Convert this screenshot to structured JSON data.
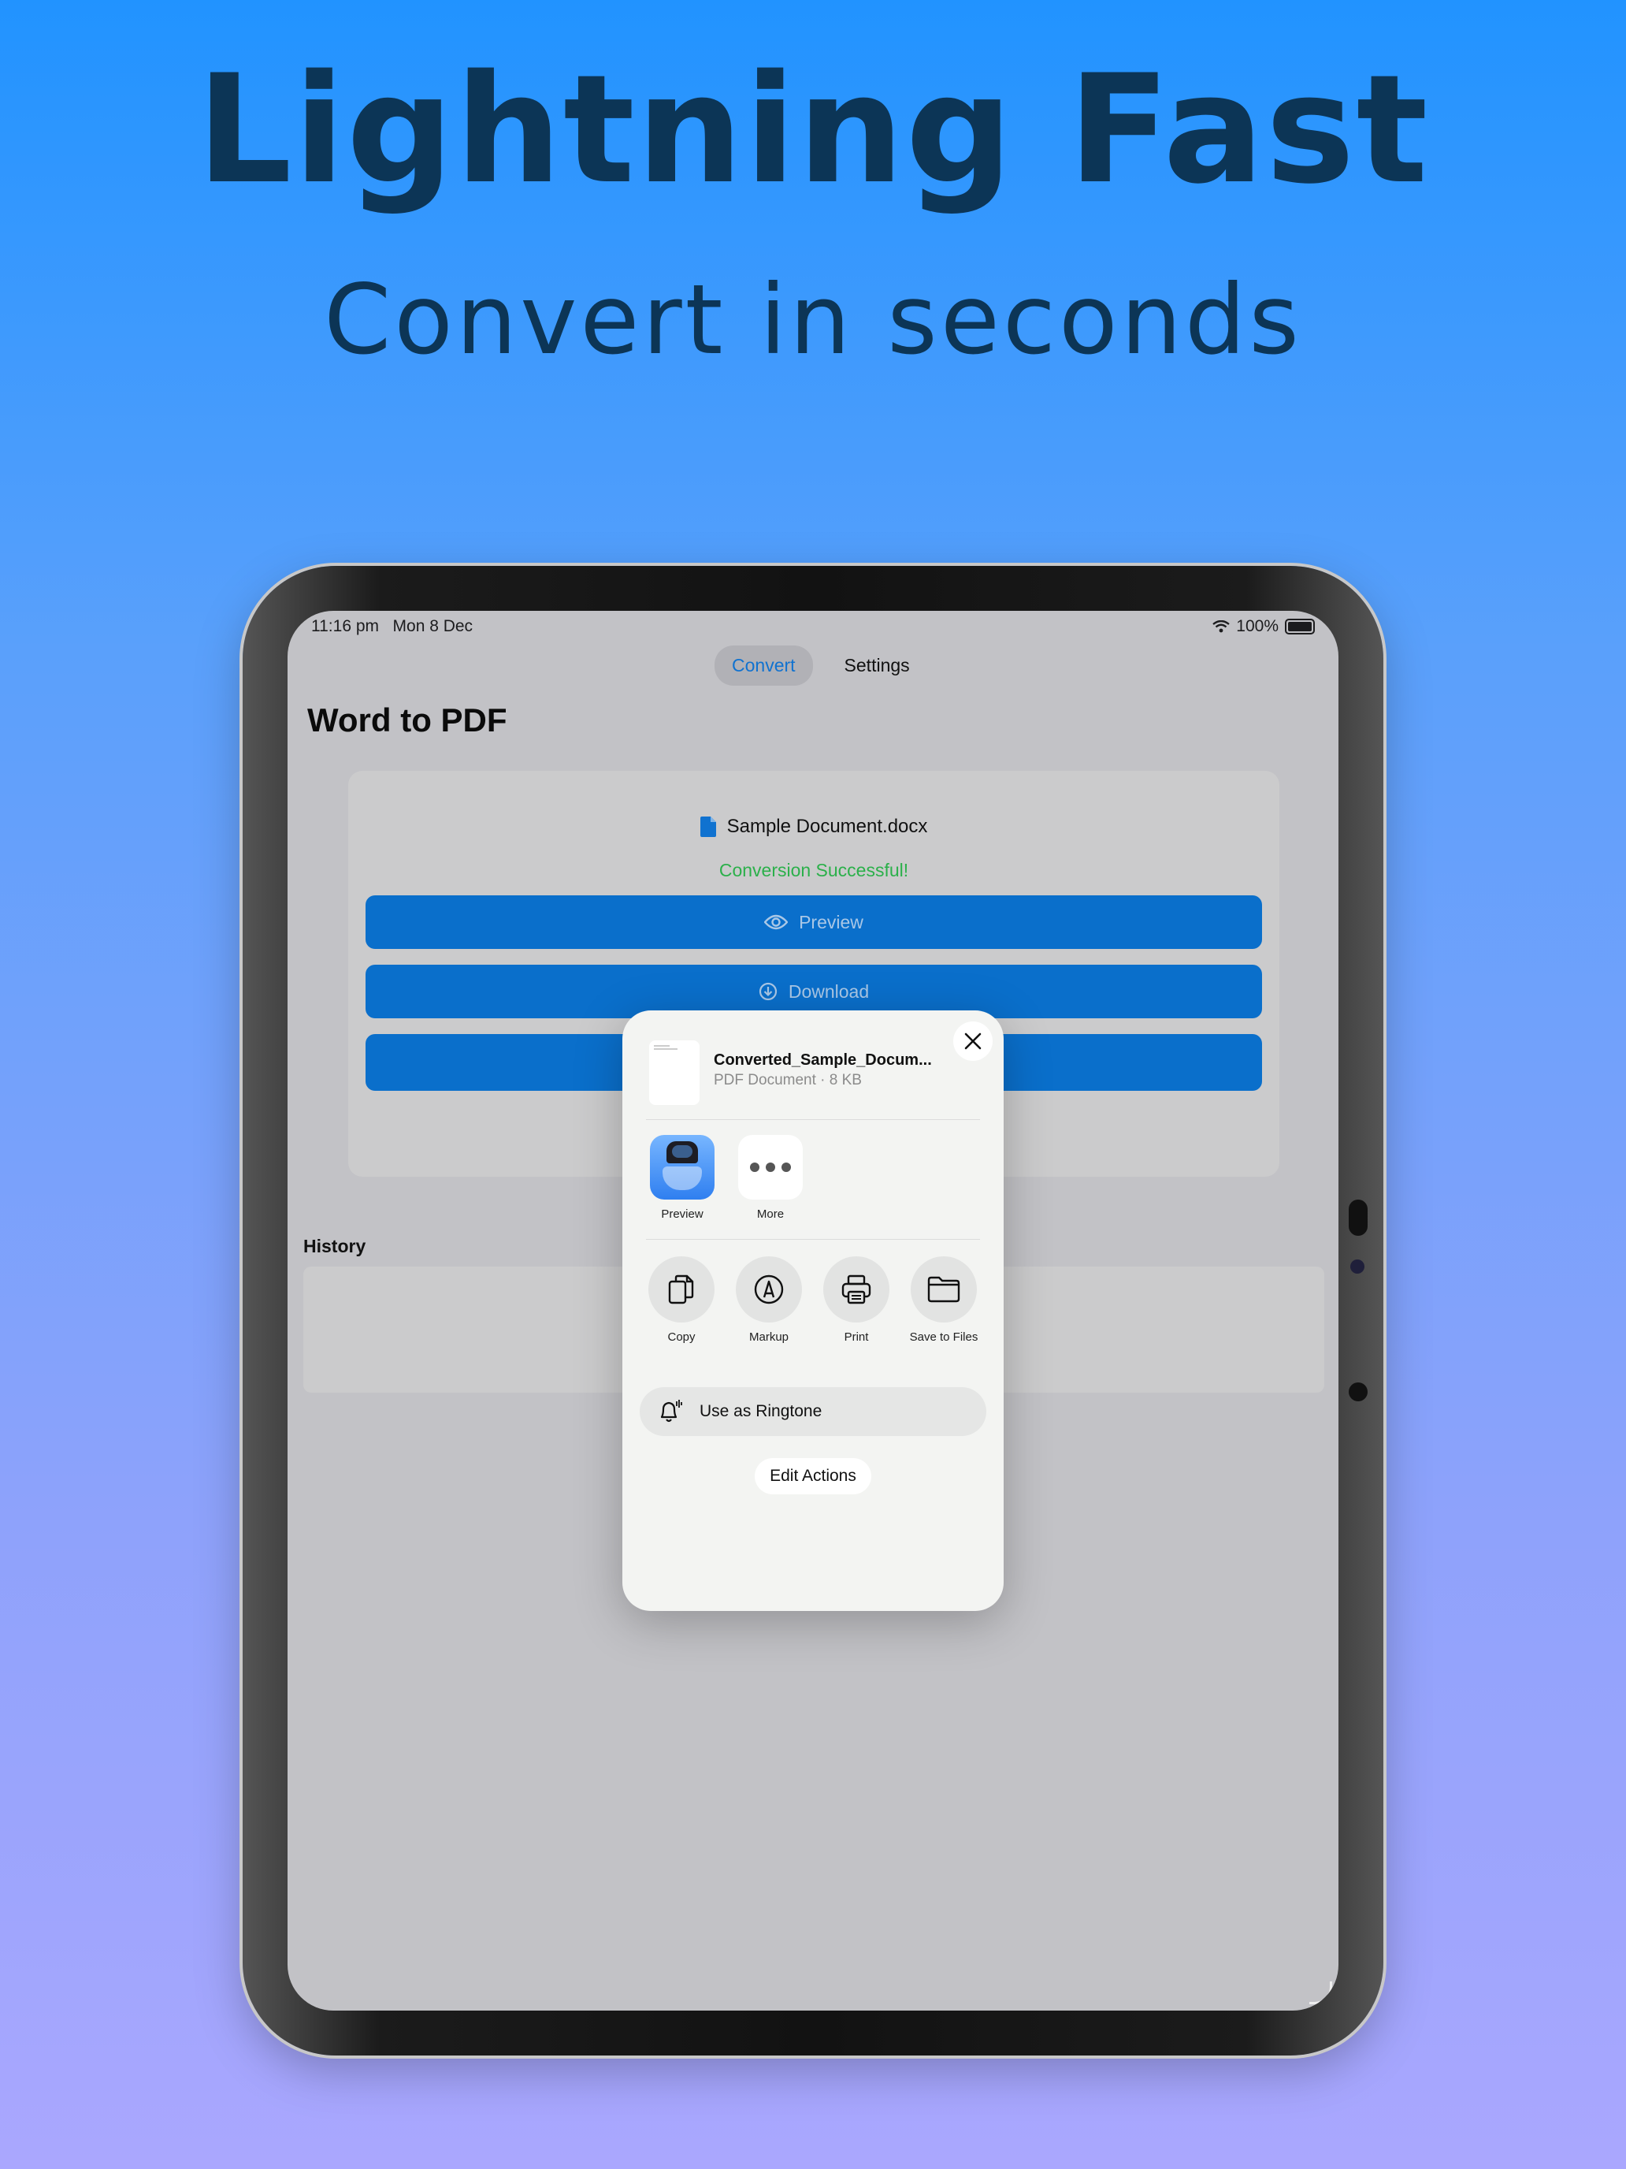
{
  "hero": {
    "title": "Lightning Fast",
    "subtitle": "Convert in seconds"
  },
  "status_bar": {
    "time": "11:16 pm",
    "date": "Mon 8 Dec",
    "battery": "100%"
  },
  "tabs": [
    {
      "label": "Convert",
      "active": true
    },
    {
      "label": "Settings",
      "active": false
    }
  ],
  "page": {
    "title": "Word to PDF",
    "file_name": "Sample Document.docx",
    "status": "Conversion Successful!",
    "preview_label": "Preview",
    "download_label": "Download",
    "history_label": "History"
  },
  "share_sheet": {
    "file_name": "Converted_Sample_Docum...",
    "file_meta": "PDF Document · 8 KB",
    "apps": [
      {
        "label": "Preview",
        "icon": "preview-app-icon"
      },
      {
        "label": "More",
        "icon": "more-icon"
      }
    ],
    "actions": [
      {
        "label": "Copy",
        "icon": "copy-icon"
      },
      {
        "label": "Markup",
        "icon": "markup-icon"
      },
      {
        "label": "Print",
        "icon": "print-icon"
      },
      {
        "label": "Save to Files",
        "icon": "folder-icon"
      }
    ],
    "ringtone_label": "Use as Ringtone",
    "edit_actions_label": "Edit Actions"
  },
  "colors": {
    "accent": "#0a6fcb",
    "success": "#2bb04a",
    "headline": "#0c3556"
  }
}
